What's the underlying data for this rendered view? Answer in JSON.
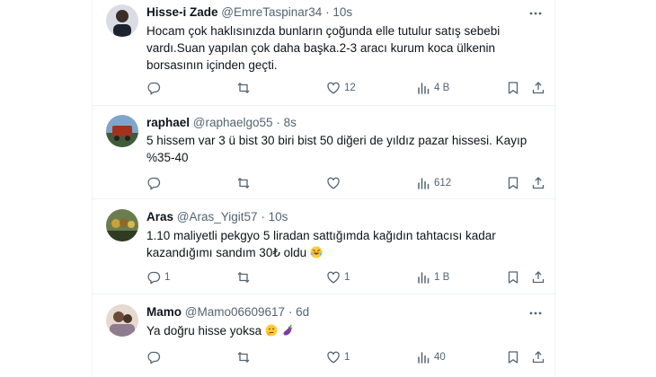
{
  "tweets": [
    {
      "name": "Hisse-i Zade",
      "handle": "@EmreTaspinar34",
      "separator": "·",
      "time": "10s",
      "text": "Hocam çok haklısınızda bunların çoğunda elle tutulur satış sebebi vardı.Suan yapılan çok daha başka.2-3 aracı kurum koca ülkenin borsasının içinden geçti.",
      "reply_count": "",
      "retweet_count": "",
      "like_count": "12",
      "view_count": "4 B"
    },
    {
      "name": "raphael",
      "handle": "@raphaelgo55",
      "separator": "·",
      "time": "8s",
      "text": "5 hissem var 3 ü bist 30 biri bist 50 diğeri de yıldız pazar hissesi. Kayıp %35-40",
      "reply_count": "",
      "retweet_count": "",
      "like_count": "",
      "view_count": "612"
    },
    {
      "name": "Aras",
      "handle": "@Aras_Yigit57",
      "separator": "·",
      "time": "10s",
      "text": "1.10 maliyetli pekgyo 5 liradan sattığımda  kağıdın tahtacısı kadar kazandığımı sandım 30₺ oldu",
      "reply_count": "1",
      "retweet_count": "",
      "like_count": "1",
      "view_count": "1 B"
    },
    {
      "name": "Mamo",
      "handle": "@Mamo06609617",
      "separator": "·",
      "time": "6d",
      "text": "Ya doğru hisse yoksa",
      "reply_count": "",
      "retweet_count": "",
      "like_count": "1",
      "view_count": "40"
    }
  ],
  "icons": {
    "more": "more-icon",
    "reply": "reply-icon",
    "retweet": "retweet-icon",
    "like": "like-icon",
    "views": "views-icon",
    "bookmark": "bookmark-icon",
    "share": "share-icon"
  },
  "colors": {
    "text": "#0f1419",
    "secondary": "#536471",
    "divider": "#eff3f4"
  }
}
